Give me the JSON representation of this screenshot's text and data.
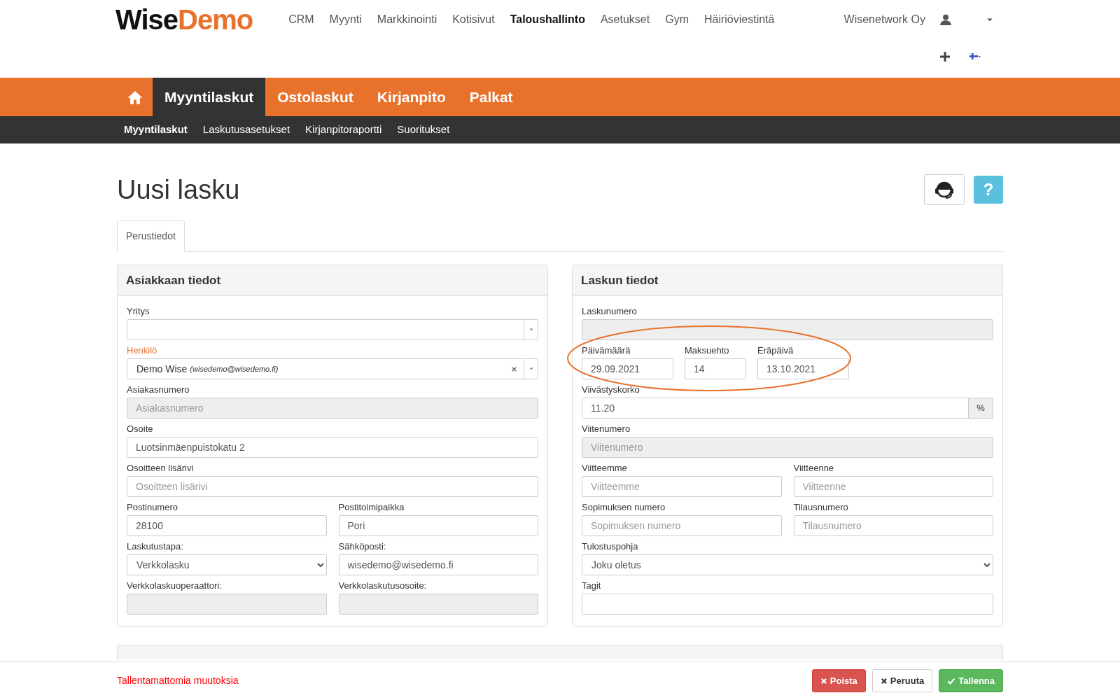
{
  "logo": {
    "first": "Wise",
    "second": "Demo"
  },
  "top_nav": [
    {
      "label": "CRM",
      "selected": false
    },
    {
      "label": "Myynti",
      "selected": false
    },
    {
      "label": "Markkinointi",
      "selected": false
    },
    {
      "label": "Kotisivut",
      "selected": false
    },
    {
      "label": "Taloushallinto",
      "selected": true
    },
    {
      "label": "Asetukset",
      "selected": false
    },
    {
      "label": "Gym",
      "selected": false
    },
    {
      "label": "Häiriöviestintä",
      "selected": false
    }
  ],
  "company": "Wisenetwork Oy",
  "main_nav": [
    {
      "label": "Myyntilaskut",
      "selected": true
    },
    {
      "label": "Ostolaskut",
      "selected": false
    },
    {
      "label": "Kirjanpito",
      "selected": false
    },
    {
      "label": "Palkat",
      "selected": false
    }
  ],
  "sub_nav": [
    {
      "label": "Myyntilaskut",
      "selected": true
    },
    {
      "label": "Laskutusasetukset",
      "selected": false
    },
    {
      "label": "Kirjanpitoraportti",
      "selected": false
    },
    {
      "label": "Suoritukset",
      "selected": false
    }
  ],
  "page_title": "Uusi lasku",
  "help_button": "?",
  "tabs": [
    {
      "label": "Perustiedot",
      "selected": true
    }
  ],
  "customer_panel": {
    "title": "Asiakkaan tiedot",
    "rows": [
      {
        "kind": "columns",
        "fields": [
          {
            "label": "Yritys",
            "kind": "combo",
            "required": false,
            "disabled": false
          }
        ]
      },
      {
        "kind": "columns",
        "fields": [
          {
            "label": "Henkilö",
            "kind": "combo",
            "required": true,
            "disabled": false,
            "value": "Demo Wise",
            "note": "(wisedemo@wisedemo.fi)",
            "clearable": true
          }
        ]
      },
      {
        "kind": "columns",
        "fields": [
          {
            "label": "Asiakasnumero",
            "kind": "text",
            "required": false,
            "disabled": true,
            "placeholder": "Asiakasnumero"
          }
        ]
      },
      {
        "kind": "columns",
        "fields": [
          {
            "label": "Osoite",
            "kind": "text",
            "required": false,
            "disabled": false,
            "value": "Luotsinmäenpuistokatu 2"
          }
        ]
      },
      {
        "kind": "columns",
        "fields": [
          {
            "label": "Osoitteen lisärivi",
            "kind": "text",
            "required": false,
            "disabled": false,
            "placeholder": "Osoitteen lisärivi"
          }
        ]
      },
      {
        "kind": "columns",
        "fields": [
          {
            "label": "Postinumero",
            "kind": "text",
            "required": false,
            "disabled": false,
            "value": "28100"
          },
          {
            "label": "Postitoimipaikka",
            "kind": "text",
            "required": false,
            "disabled": false,
            "value": "Pori"
          }
        ]
      },
      {
        "kind": "columns",
        "fields": [
          {
            "label": "Laskutustapa:",
            "kind": "select",
            "required": false,
            "disabled": false,
            "value": "Verkkolasku"
          },
          {
            "label": "Sähköposti:",
            "kind": "text",
            "required": false,
            "disabled": false,
            "value": "wisedemo@wisedemo.fi"
          }
        ]
      },
      {
        "kind": "columns",
        "fields": [
          {
            "label": "Verkkolaskuoperaattori:",
            "kind": "text",
            "required": false,
            "disabled": true
          },
          {
            "label": "Verkkolaskutusosoite:",
            "kind": "text",
            "required": false,
            "disabled": true
          }
        ]
      }
    ]
  },
  "invoice_panel": {
    "title": "Laskun tiedot",
    "rows": [
      {
        "kind": "columns",
        "fields": [
          {
            "label": "Laskunumero",
            "kind": "text",
            "required": false,
            "disabled": true
          }
        ]
      },
      {
        "kind": "dates",
        "fields": [
          {
            "label": "Päivämäärä",
            "kind": "text",
            "required": false,
            "disabled": false,
            "value": "29.09.2021"
          },
          {
            "label": "Maksuehto",
            "kind": "text",
            "required": false,
            "disabled": false,
            "value": "14"
          },
          {
            "label": "Eräpäivä",
            "kind": "text",
            "required": false,
            "disabled": false,
            "value": "13.10.2021"
          }
        ]
      },
      {
        "kind": "columns",
        "fields": [
          {
            "label": "Viivästyskorko",
            "kind": "addon",
            "required": false,
            "disabled": false,
            "value": "11.20",
            "addon": "%"
          }
        ]
      },
      {
        "kind": "columns",
        "fields": [
          {
            "label": "Viitenumero",
            "kind": "text",
            "required": false,
            "disabled": true,
            "placeholder": "Viitenumero"
          }
        ]
      },
      {
        "kind": "columns",
        "fields": [
          {
            "label": "Viitteemme",
            "kind": "text",
            "required": false,
            "disabled": false,
            "placeholder": "Viitteemme"
          },
          {
            "label": "Viitteenne",
            "kind": "text",
            "required": false,
            "disabled": false,
            "placeholder": "Viitteenne"
          }
        ]
      },
      {
        "kind": "columns",
        "fields": [
          {
            "label": "Sopimuksen numero",
            "kind": "text",
            "required": false,
            "disabled": false,
            "placeholder": "Sopimuksen numero"
          },
          {
            "label": "Tilausnumero",
            "kind": "text",
            "required": false,
            "disabled": false,
            "placeholder": "Tilausnumero"
          }
        ]
      },
      {
        "kind": "columns",
        "fields": [
          {
            "label": "Tulostuspohja",
            "kind": "select",
            "required": false,
            "disabled": false,
            "value": "Joku oletus"
          }
        ]
      },
      {
        "kind": "columns",
        "fields": [
          {
            "label": "Tagit",
            "kind": "text",
            "required": false,
            "disabled": false
          }
        ]
      }
    ]
  },
  "footer": {
    "message": "Tallentamattomia muutoksia",
    "buttons": [
      {
        "label": "Poista",
        "kind": "danger"
      },
      {
        "label": "Peruuta",
        "kind": "default"
      },
      {
        "label": "Tallenna",
        "kind": "success"
      }
    ]
  }
}
